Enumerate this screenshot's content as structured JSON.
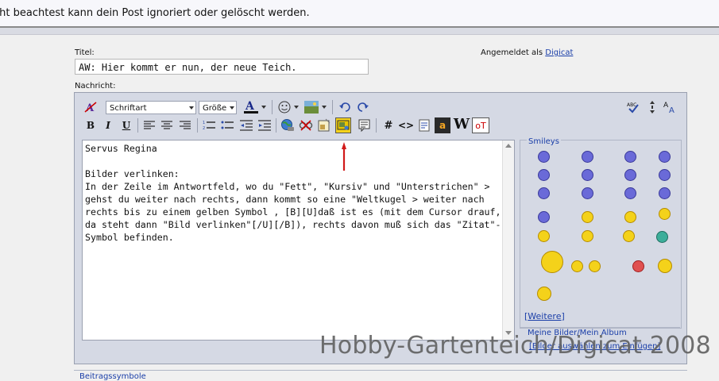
{
  "top_notice": "cht beachtest kann dein Post ignoriert oder gelöscht werden.",
  "form": {
    "title_label": "Titel:",
    "title_value": "AW: Hier kommt er nun, der neue Teich.",
    "message_label": "Nachricht:",
    "logged_in_text": "Angemeldet als",
    "logged_in_user": "Digicat"
  },
  "toolbar": {
    "font_select": "Schriftart",
    "size_select": "Größe",
    "font_color_letter": "A",
    "bold": "B",
    "italic": "I",
    "underline": "U",
    "hash": "#",
    "code": "<>",
    "offtopic": "oT",
    "wiki": "W",
    "amazon": "a",
    "spell_icon": "ABC"
  },
  "message": {
    "text": "Servus Regina\n\nBilder verlinken:\nIn der Zeile im Antwortfeld, wo du \"Fett\", \"Kursiv\" und \"Unterstrichen\" > gehst du weiter nach rechts, dann kommt so eine \"Weltkugel > weiter nach rechts bis zu einem gelben Symbol , [B][U]daß ist es (mit dem Cursor drauf, da steht dann \"Bild verlinken\"[/U][/B]), rechts davon muß sich das \"Zitat\"-Symbol befinden."
  },
  "smileys": {
    "legend": "Smileys",
    "more_prefix": "[",
    "more_link": "Weitere",
    "more_suffix": "]"
  },
  "album": {
    "title": "Meine Bilder/Mein Album",
    "link": "[Bilder auswählen zum Einfügen]"
  },
  "watermark": "Hobby-Gartenteich/Digicat 2008",
  "bottom_section": "Beitragssymbole",
  "colors": {
    "accent_link": "#1a3ea8",
    "editor_bg": "#d5d9e4",
    "arrow": "#d11a1a"
  }
}
